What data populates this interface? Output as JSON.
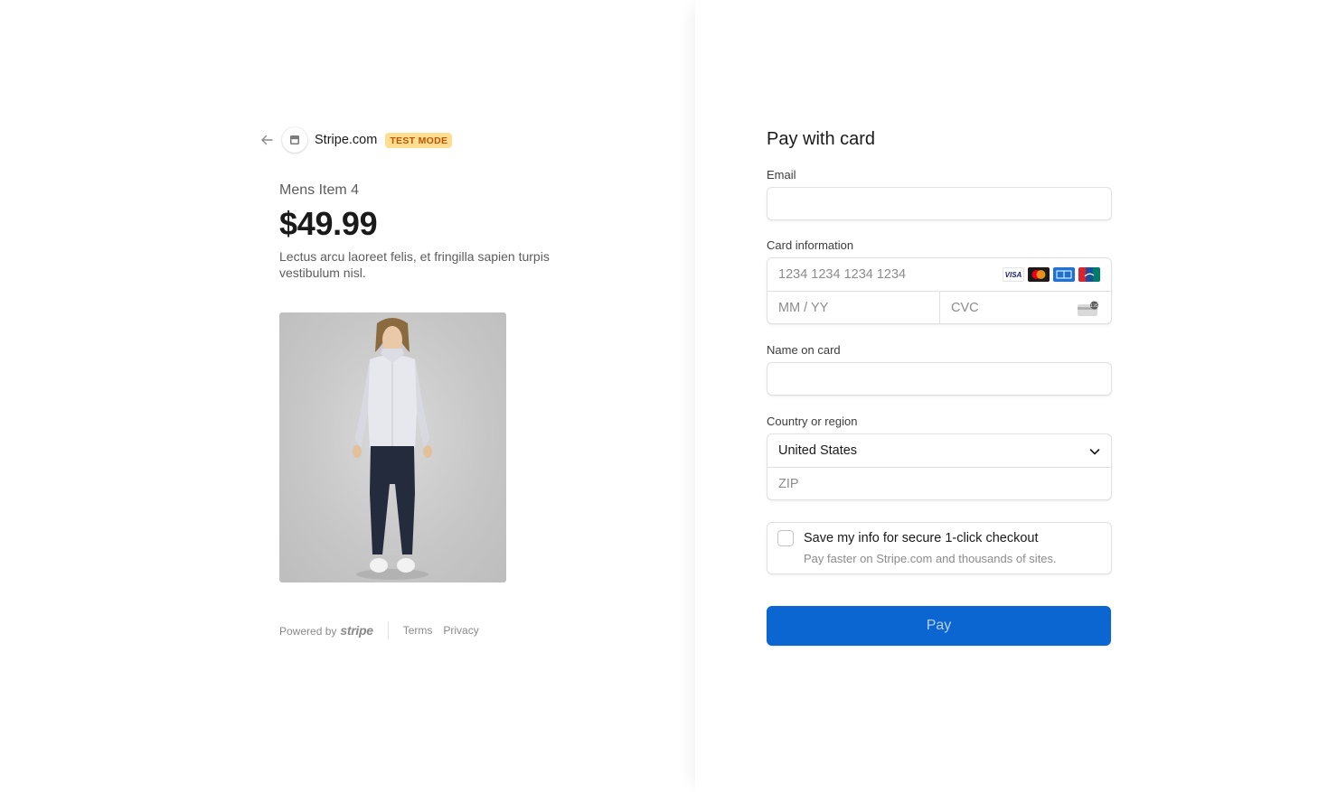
{
  "merchant": {
    "name": "Stripe.com",
    "badge": "TEST MODE"
  },
  "product": {
    "name": "Mens Item 4",
    "price": "$49.99",
    "description": "Lectus arcu laoreet felis, et fringilla sapien turpis vestibulum nisl."
  },
  "footer": {
    "powered_by": "Powered by",
    "brand": "stripe",
    "terms": "Terms",
    "privacy": "Privacy"
  },
  "form": {
    "title": "Pay with card",
    "email_label": "Email",
    "email_value": "",
    "card_label": "Card information",
    "card_number_placeholder": "1234 1234 1234 1234",
    "expiry_placeholder": "MM / YY",
    "cvc_placeholder": "CVC",
    "name_label": "Name on card",
    "name_value": "",
    "country_label": "Country or region",
    "country_value": "United States",
    "zip_placeholder": "ZIP",
    "save_title": "Save my info for secure 1-click checkout",
    "save_subtitle": "Pay faster on Stripe.com and thousands of sites.",
    "save_checked": false,
    "pay_label": "Pay"
  },
  "icons": {
    "back": "back-arrow-icon",
    "store": "store-icon",
    "brands": [
      "visa-icon",
      "mastercard-icon",
      "amex-icon",
      "unionpay-icon"
    ],
    "cvc": "cvc-card-icon",
    "chevron": "chevron-down-icon"
  },
  "colors": {
    "accent": "#0b66d1",
    "badge_bg": "#ffde92",
    "badge_text": "#bb5504"
  }
}
